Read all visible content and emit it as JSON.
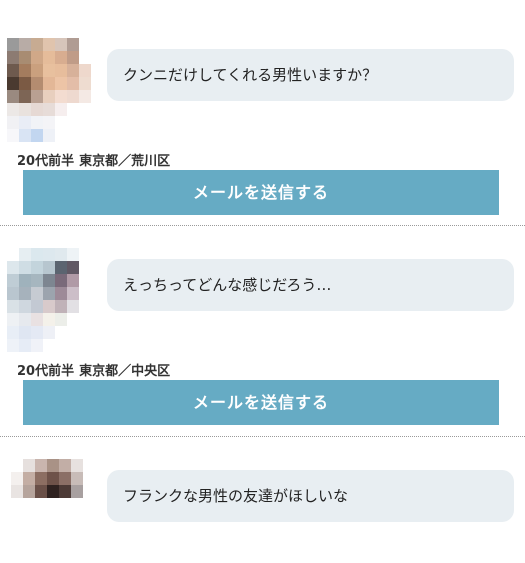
{
  "posts": [
    {
      "message": "クンニだけしてくれる男性いますか？",
      "age": "20代前半",
      "location": "東京都／荒川区",
      "button_label": "メールを送信する",
      "avatar_pixels": [
        [
          "#9a9a9a",
          "#b8aca6",
          "#c7ab92",
          "#e0c4ad",
          "#d7c5ba",
          "#b09c93",
          "#ffffff",
          "#ffffff"
        ],
        [
          "#8c7b72",
          "#a88c72",
          "#d0a888",
          "#e5bc9a",
          "#d8ad90",
          "#c09c88",
          "#ffffff",
          "#ffffff"
        ],
        [
          "#6e5a4e",
          "#a47c5e",
          "#caa07e",
          "#e8c09e",
          "#e7bd9c",
          "#d7b19a",
          "#eed8cc",
          "#ffffff"
        ],
        [
          "#4a3a30",
          "#7b5a44",
          "#b48c70",
          "#e3b797",
          "#edc4a6",
          "#e3bda8",
          "#eedcd0",
          "#ffffff"
        ],
        [
          "#9a8a80",
          "#7d6555",
          "#b9a092",
          "#e8cfbe",
          "#f3dcd0",
          "#eed9cf",
          "#f4e9e4",
          "#ffffff"
        ],
        [
          "#ece8e6",
          "#e9e2de",
          "#e6d9d4",
          "#e7dcd8",
          "#f6eeee",
          "#ffffff",
          "#ffffff",
          "#ffffff"
        ],
        [
          "#f1f1f4",
          "#e9edf6",
          "#f1f3f7",
          "#f4f4f7",
          "#ffffff",
          "#ffffff",
          "#ffffff",
          "#ffffff"
        ],
        [
          "#f7f7fa",
          "#d9e4f4",
          "#c2d6f0",
          "#eef1f7",
          "#ffffff",
          "#ffffff",
          "#ffffff",
          "#ffffff"
        ]
      ]
    },
    {
      "message": "えっちってどんな感じだろう…",
      "age": "20代前半",
      "location": "東京都／中央区",
      "button_label": "メールを送信する",
      "avatar_pixels": [
        [
          "#ffffff",
          "#e6eef2",
          "#dbe8ee",
          "#dde8ee",
          "#e0e9ee",
          "#eef3f6",
          "#ffffff",
          "#ffffff"
        ],
        [
          "#dde7ec",
          "#cfdde4",
          "#c3d4dc",
          "#b7c6cf",
          "#5b6470",
          "#605864",
          "#ffffff",
          "#ffffff"
        ],
        [
          "#bfcdd5",
          "#9fb2bc",
          "#a6b6bf",
          "#7d8691",
          "#7a6a7a",
          "#b09aa6",
          "#ffffff",
          "#ffffff"
        ],
        [
          "#b9c6cf",
          "#a6b2bc",
          "#c6cbd2",
          "#9ca4ae",
          "#9d8a98",
          "#ccbec8",
          "#ffffff",
          "#ffffff"
        ],
        [
          "#d9e1e6",
          "#cfd7df",
          "#c3c9d3",
          "#d8cacb",
          "#c0b2b8",
          "#e2e0e4",
          "#ffffff",
          "#ffffff"
        ],
        [
          "#eef1f4",
          "#e6e9ee",
          "#e9e1e2",
          "#f4f1ea",
          "#eceee9",
          "#ffffff",
          "#ffffff",
          "#ffffff"
        ],
        [
          "#e8eef6",
          "#dfe6f2",
          "#e4e9f4",
          "#eef0f6",
          "#ffffff",
          "#ffffff",
          "#ffffff",
          "#ffffff"
        ],
        [
          "#eef2f8",
          "#e6ecf6",
          "#f0f2f8",
          "#ffffff",
          "#ffffff",
          "#ffffff",
          "#ffffff",
          "#ffffff"
        ]
      ]
    },
    {
      "message": "フランクな男性の友達がほしいな",
      "avatar_pixels": [
        [
          "#ffffff",
          "#e6e0de",
          "#c9b5ae",
          "#a99286",
          "#c2aea6",
          "#e7e1df",
          "#ffffff",
          "#ffffff"
        ],
        [
          "#f4f0ee",
          "#c4aea4",
          "#8c6e62",
          "#6e5249",
          "#8b6f66",
          "#c8bcb8",
          "#ffffff",
          "#ffffff"
        ],
        [
          "#e9e4e2",
          "#b6a49c",
          "#6a5048",
          "#2f2220",
          "#4c3a36",
          "#a8a0a0",
          "#ffffff",
          "#ffffff"
        ]
      ]
    }
  ]
}
